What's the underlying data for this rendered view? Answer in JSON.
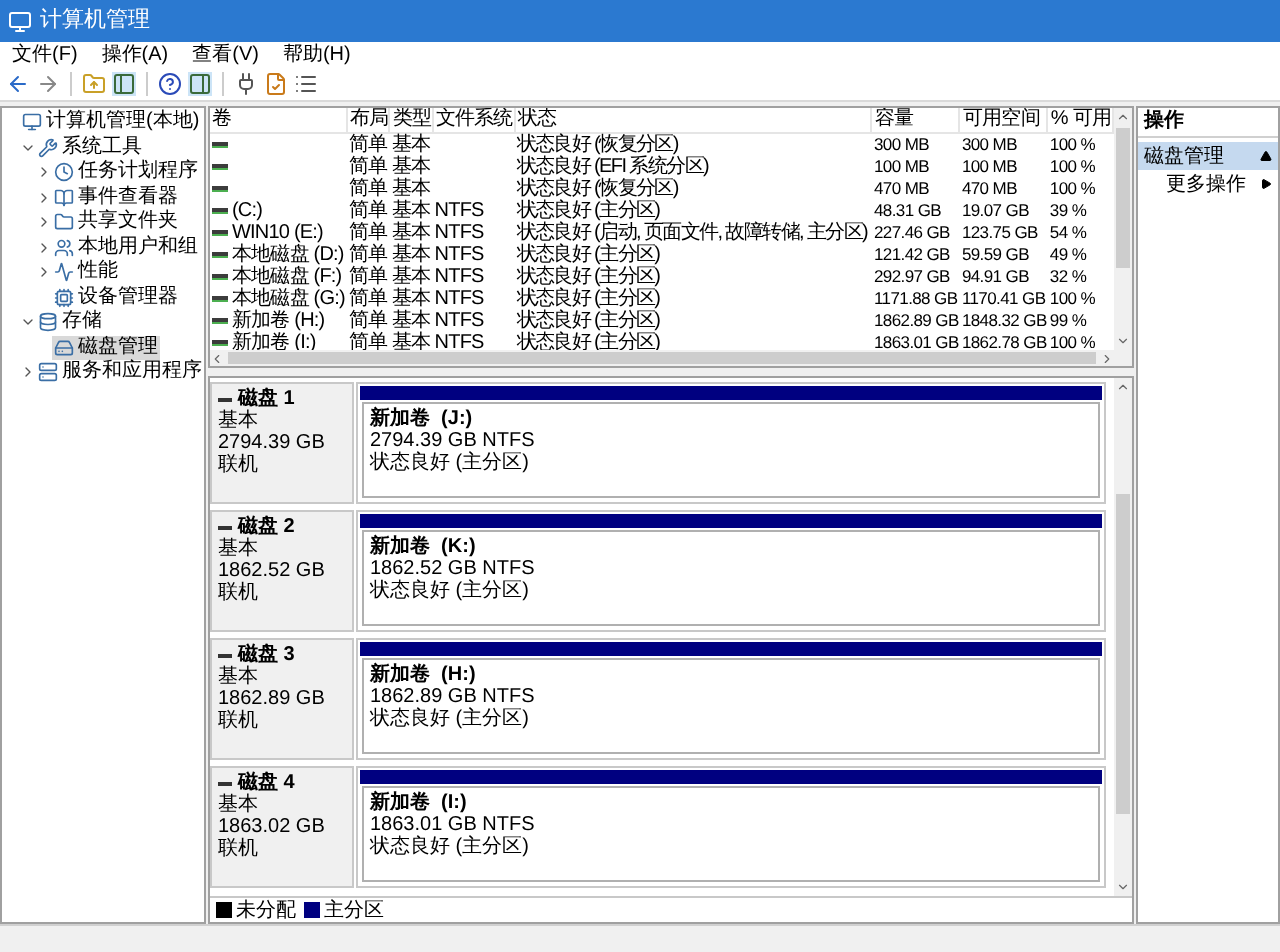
{
  "window": {
    "title": "计算机管理"
  },
  "menu": [
    {
      "label": "文件(F)"
    },
    {
      "label": "操作(A)"
    },
    {
      "label": "查看(V)"
    },
    {
      "label": "帮助(H)"
    }
  ],
  "tree": [
    {
      "label": "计算机管理(本地)",
      "kind": "computer",
      "selected": false,
      "children": [
        {
          "label": "系统工具",
          "kind": "tools",
          "expanded": true,
          "selected": false,
          "children": [
            {
              "label": "任务计划程序",
              "kind": "scheduler",
              "expanded": false,
              "selected": false
            },
            {
              "label": "事件查看器",
              "kind": "events",
              "expanded": false,
              "selected": false
            },
            {
              "label": "共享文件夹",
              "kind": "shared",
              "expanded": false,
              "selected": false
            },
            {
              "label": "本地用户和组",
              "kind": "users",
              "expanded": false,
              "selected": false
            },
            {
              "label": "性能",
              "kind": "performance",
              "expanded": false,
              "selected": false
            },
            {
              "label": "设备管理器",
              "kind": "devices",
              "selected": false
            }
          ]
        },
        {
          "label": "存储",
          "kind": "storage",
          "expanded": true,
          "selected": false,
          "children": [
            {
              "label": "磁盘管理",
              "kind": "disk",
              "selected": true
            }
          ]
        },
        {
          "label": "服务和应用程序",
          "kind": "services",
          "expanded": false,
          "selected": false
        }
      ]
    }
  ],
  "table": {
    "columns": [
      "卷",
      "布局",
      "类型",
      "文件系统",
      "状态",
      "容量",
      "可用空间",
      "% 可用"
    ],
    "rows": [
      [
        "",
        "简单",
        "基本",
        "",
        "状态良好 (恢复分区)",
        "300 MB",
        "300 MB",
        "100 %"
      ],
      [
        "",
        "简单",
        "基本",
        "",
        "状态良好 (EFI 系统分区)",
        "100 MB",
        "100 MB",
        "100 %"
      ],
      [
        "",
        "简单",
        "基本",
        "",
        "状态良好 (恢复分区)",
        "470 MB",
        "470 MB",
        "100 %"
      ],
      [
        "(C:)",
        "简单",
        "基本",
        "NTFS",
        "状态良好 (主分区)",
        "48.31 GB",
        "19.07 GB",
        "39 %"
      ],
      [
        "WIN10 (E:)",
        "简单",
        "基本",
        "NTFS",
        "状态良好 (启动, 页面文件, 故障转储, 主分区)",
        "227.46 GB",
        "123.75 GB",
        "54 %"
      ],
      [
        "本地磁盘 (D:)",
        "简单",
        "基本",
        "NTFS",
        "状态良好 (主分区)",
        "121.42 GB",
        "59.59 GB",
        "49 %"
      ],
      [
        "本地磁盘 (F:)",
        "简单",
        "基本",
        "NTFS",
        "状态良好 (主分区)",
        "292.97 GB",
        "94.91 GB",
        "32 %"
      ],
      [
        "本地磁盘 (G:)",
        "简单",
        "基本",
        "NTFS",
        "状态良好 (主分区)",
        "1171.88 GB",
        "1170.41 GB",
        "100 %"
      ],
      [
        "新加卷 (H:)",
        "简单",
        "基本",
        "NTFS",
        "状态良好 (主分区)",
        "1862.89 GB",
        "1848.32 GB",
        "99 %"
      ],
      [
        "新加卷 (I:)",
        "简单",
        "基本",
        "NTFS",
        "状态良好 (主分区)",
        "1863.01 GB",
        "1862.78 GB",
        "100 %"
      ]
    ]
  },
  "disks": [
    {
      "name": "磁盘 1",
      "type": "基本",
      "size": "2794.39 GB",
      "status": "联机",
      "partition": {
        "label": "新加卷  (J:)",
        "size": "2794.39 GB NTFS",
        "status": "状态良好 (主分区)",
        "color": "#000080"
      }
    },
    {
      "name": "磁盘 2",
      "type": "基本",
      "size": "1862.52 GB",
      "status": "联机",
      "partition": {
        "label": "新加卷  (K:)",
        "size": "1862.52 GB NTFS",
        "status": "状态良好 (主分区)",
        "color": "#000080"
      }
    },
    {
      "name": "磁盘 3",
      "type": "基本",
      "size": "1862.89 GB",
      "status": "联机",
      "partition": {
        "label": "新加卷  (H:)",
        "size": "1862.89 GB NTFS",
        "status": "状态良好 (主分区)",
        "color": "#000080"
      }
    },
    {
      "name": "磁盘 4",
      "type": "基本",
      "size": "1863.02 GB",
      "status": "联机",
      "partition": {
        "label": "新加卷  (I:)",
        "size": "1863.01 GB NTFS",
        "status": "状态良好 (主分区)",
        "color": "#000080"
      }
    }
  ],
  "legend": [
    {
      "label": "未分配",
      "color": "#000000"
    },
    {
      "label": "主分区",
      "color": "#000080"
    }
  ],
  "actions": {
    "title": "操作",
    "section": {
      "label": "磁盘管理",
      "expanded": true
    },
    "items": [
      {
        "label": "更多操作"
      }
    ]
  }
}
